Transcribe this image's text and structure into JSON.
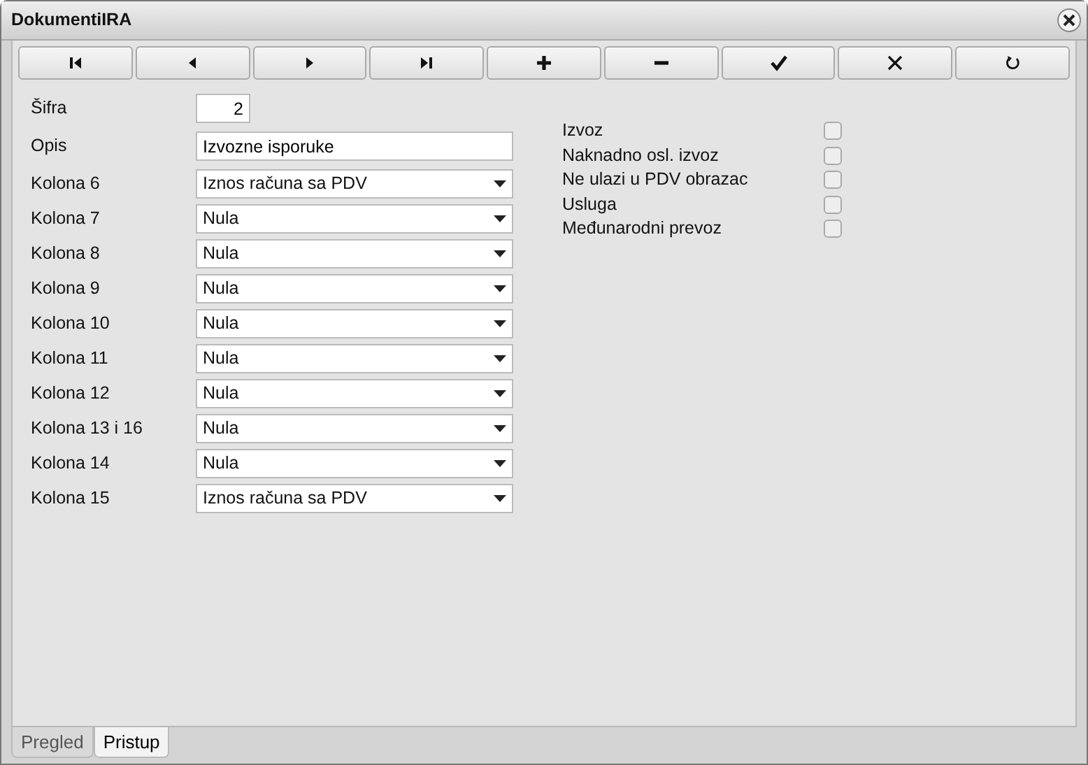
{
  "window": {
    "title": "DokumentiIRA"
  },
  "toolbar": [
    {
      "kind": "first"
    },
    {
      "kind": "prev"
    },
    {
      "kind": "next"
    },
    {
      "kind": "last"
    },
    {
      "kind": "add"
    },
    {
      "kind": "remove"
    },
    {
      "kind": "confirm"
    },
    {
      "kind": "cancel"
    },
    {
      "kind": "refresh"
    }
  ],
  "code": {
    "label": "Šifra",
    "value": "2"
  },
  "description": {
    "label": "Opis",
    "value": "Izvozne isporuke"
  },
  "columns": [
    {
      "label": "Kolona 6",
      "value": "Iznos računa sa PDV"
    },
    {
      "label": "Kolona 7",
      "value": "Nula"
    },
    {
      "label": "Kolona 8",
      "value": "Nula"
    },
    {
      "label": "Kolona 9",
      "value": "Nula"
    },
    {
      "label": "Kolona 10",
      "value": "Nula"
    },
    {
      "label": "Kolona 11",
      "value": "Nula"
    },
    {
      "label": "Kolona 12",
      "value": "Nula"
    },
    {
      "label": "Kolona 13 i 16",
      "value": "Nula"
    },
    {
      "label": "Kolona 14",
      "value": "Nula"
    },
    {
      "label": "Kolona 15",
      "value": "Iznos računa sa PDV"
    }
  ],
  "flags": [
    {
      "label": "Izvoz",
      "checked": false
    },
    {
      "label": "Naknadno osl. izvoz",
      "checked": false
    },
    {
      "label": "Ne ulazi u PDV obrazac",
      "checked": false
    },
    {
      "label": "Usluga",
      "checked": false
    },
    {
      "label": "Međunarodni prevoz",
      "checked": false
    }
  ],
  "tabs": [
    {
      "label": "Pregled",
      "selected": false
    },
    {
      "label": "Pristup",
      "selected": true
    }
  ]
}
